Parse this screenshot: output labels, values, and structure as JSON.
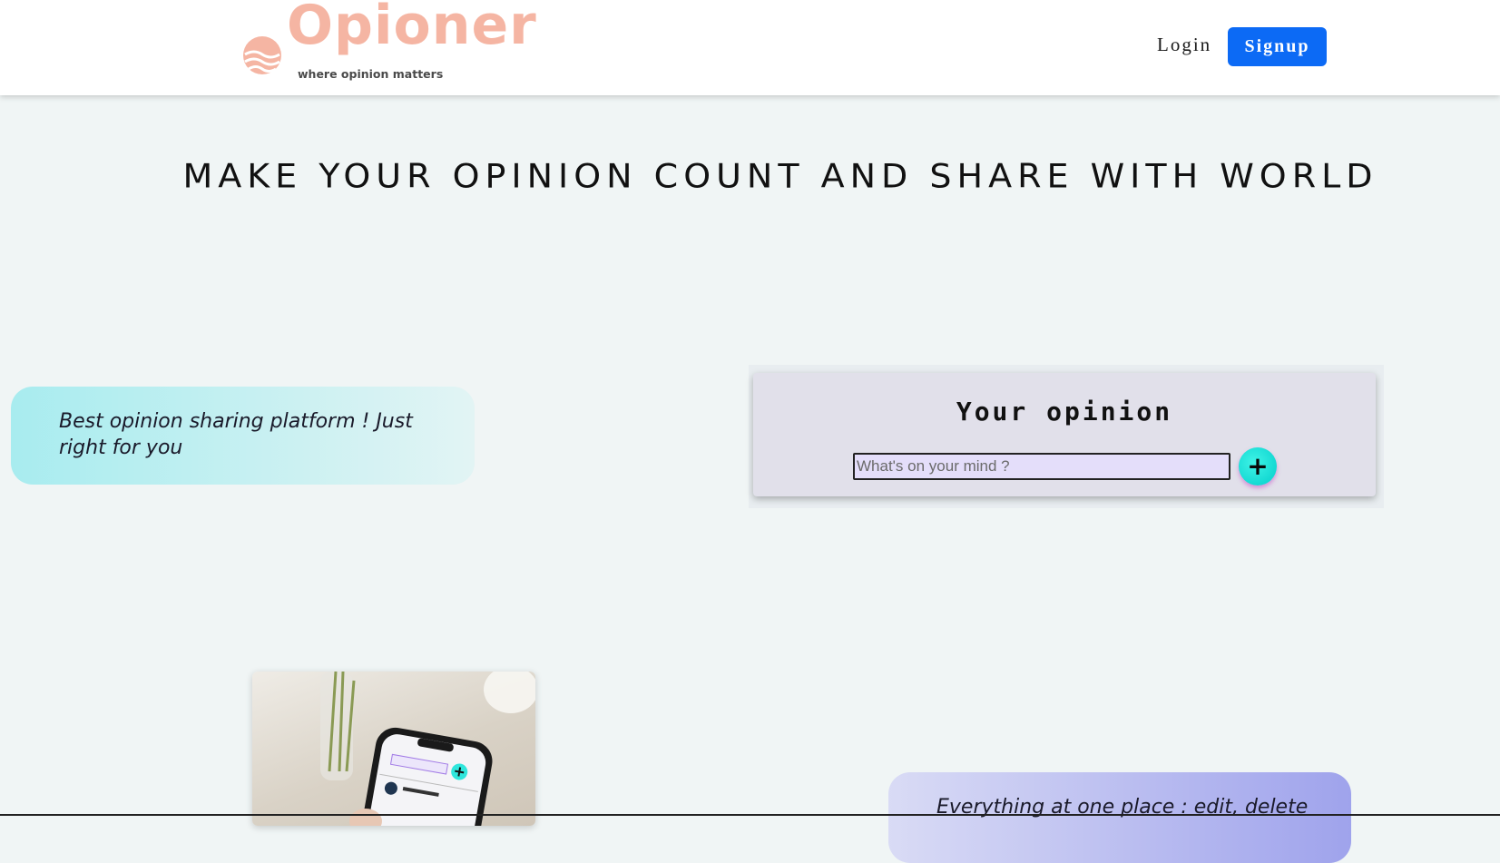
{
  "brand": {
    "name": "Opioner",
    "tagline": "where opinion matters",
    "color": "#f5b5a3"
  },
  "nav": {
    "login_label": "Login",
    "signup_label": "Signup",
    "signup_color": "#0c6af5"
  },
  "hero": {
    "headline": "MAKE YOUR OPINION COUNT AND SHARE WITH WORLD"
  },
  "features": {
    "first": "Best opinion sharing platform ! Just right for you",
    "second": "Everything at one place : edit, delete"
  },
  "opinion_form": {
    "title": "Your opinion",
    "placeholder": "What's on your mind ?",
    "add_symbol": "+"
  },
  "phone_preview": {
    "input_placeholder": "What's on your mind ?",
    "add_symbol": "+"
  }
}
